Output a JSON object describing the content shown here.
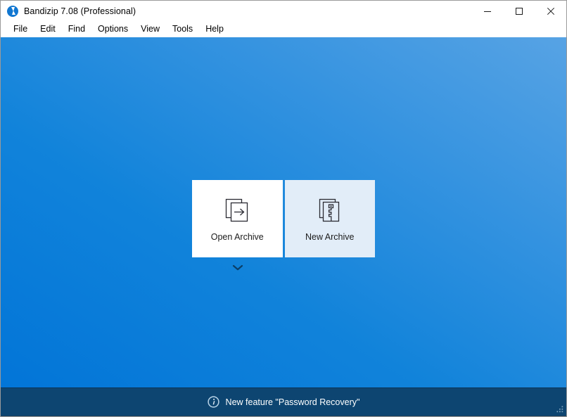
{
  "window": {
    "title": "Bandizip 7.08 (Professional)",
    "app_icon": "bandizip-logo-icon",
    "controls": [
      {
        "name": "minimize",
        "icon": "minimize-icon"
      },
      {
        "name": "maximize",
        "icon": "maximize-icon"
      },
      {
        "name": "close",
        "icon": "close-icon"
      }
    ]
  },
  "menubar": {
    "items": [
      {
        "label": "File"
      },
      {
        "label": "Edit"
      },
      {
        "label": "Find"
      },
      {
        "label": "Options"
      },
      {
        "label": "View"
      },
      {
        "label": "Tools"
      },
      {
        "label": "Help"
      }
    ]
  },
  "main": {
    "cards": [
      {
        "label": "Open Archive",
        "icon": "open-archive-icon",
        "state": "default"
      },
      {
        "label": "New Archive",
        "icon": "new-archive-icon",
        "state": "highlighted"
      }
    ],
    "expander_icon": "chevron-down-icon"
  },
  "statusbar": {
    "icon": "info-icon",
    "message": "New feature \"Password Recovery\"",
    "grip_icon": "resize-grip-icon"
  },
  "colors": {
    "canvas_blue_dark": "#0275d8",
    "canvas_blue_light": "#57a3e4",
    "card_default_bg": "#ffffff",
    "card_highlight_bg": "#e2edf8",
    "statusbar_bg": "#0d4571",
    "accent": "#1177d1",
    "chevron": "#0b3f67"
  }
}
